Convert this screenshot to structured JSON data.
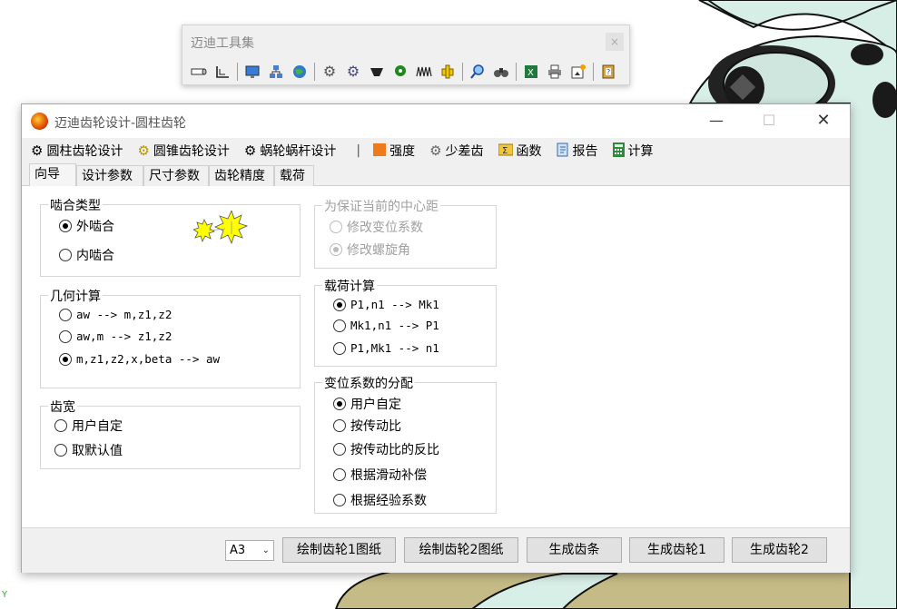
{
  "toolbar_window": {
    "title": "迈迪工具集",
    "close_glyph": "×",
    "icons": [
      "tube-icon",
      "angle-icon",
      "sep",
      "monitor-icon",
      "network-icon",
      "globe-icon",
      "sep",
      "gear-icon",
      "gear-dark-icon",
      "funnel-icon",
      "map-pin-icon",
      "spring-icon",
      "puzzle-icon",
      "sep",
      "magnifier-icon",
      "binoculars-icon",
      "sep",
      "excel-icon",
      "printer-icon",
      "image-star-icon",
      "sep",
      "help-book-icon"
    ]
  },
  "window": {
    "title": "迈迪齿轮设计-圆柱齿轮",
    "min_glyph": "—",
    "max_glyph": "☐",
    "close_glyph": "✕"
  },
  "menu": {
    "cylindrical": "圆柱齿轮设计",
    "bevel": "圆锥齿轮设计",
    "worm": "蜗轮蜗杆设计",
    "separator": "|",
    "strength": "强度",
    "few_teeth": "少差齿",
    "function": "函数",
    "report": "报告",
    "calc": "计算"
  },
  "tabs": [
    "向导",
    "设计参数",
    "尺寸参数",
    "齿轮精度",
    "载荷"
  ],
  "groups": {
    "mesh_type": {
      "legend": "啮合类型",
      "options": [
        "外啮合",
        "内啮合"
      ],
      "selected": 0
    },
    "geometry": {
      "legend": "几何计算",
      "options": [
        "aw --> m,z1,z2",
        "aw,m --> z1,z2",
        "m,z1,z2,x,beta --> aw"
      ],
      "selected": 2
    },
    "face_width": {
      "legend": "齿宽",
      "options": [
        "用户自定",
        "取默认值"
      ],
      "selected": null
    },
    "center_distance": {
      "legend": "为保证当前的中心距",
      "options": [
        "修改变位系数",
        "修改螺旋角"
      ],
      "selected": 1,
      "disabled": true
    },
    "load_calc": {
      "legend": "载荷计算",
      "options": [
        "P1,n1 --> Mk1",
        "Mk1,n1 --> P1",
        "P1,Mk1 --> n1"
      ],
      "selected": 0
    },
    "shift_distribution": {
      "legend": "变位系数的分配",
      "options": [
        "用户自定",
        "按传动比",
        "按传动比的反比",
        "根据滑动补偿",
        "根据经验系数"
      ],
      "selected": 0
    }
  },
  "footer": {
    "paper_size": "A3",
    "draw_gear1": "绘制齿轮1图纸",
    "draw_gear2": "绘制齿轮2图纸",
    "gen_rack": "生成齿条",
    "gen_gear1": "生成齿轮1",
    "gen_gear2": "生成齿轮2"
  },
  "status_marker": "Y",
  "colors": {
    "window_bg": "#f0f0f0",
    "content_bg": "#ffffff",
    "model_teal": "#d8efe9",
    "model_khaki": "#c5bb86",
    "sun_yellow": "#ffff00"
  }
}
